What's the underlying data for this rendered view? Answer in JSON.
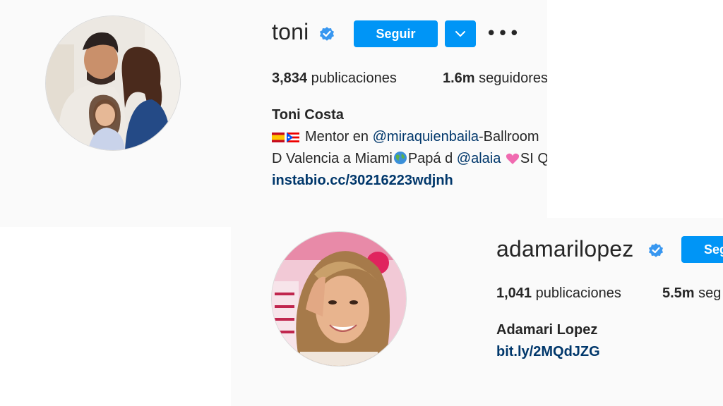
{
  "profile_1": {
    "username": "toni",
    "follow_label": "Seguir",
    "more_label": "•••",
    "posts_count": "3,834",
    "posts_label": "publicaciones",
    "followers_count": "1.6m",
    "followers_label": "seguidores",
    "full_name": "Toni Costa",
    "bio_line1_text": "Mentor en",
    "bio_line1_mention": "@miraquienbaila",
    "bio_line1_rest": "-Ballroom",
    "bio_line2_a": "D Valencia a Miami",
    "bio_line2_b": "Papá d",
    "bio_line2_mention": "@alaia",
    "bio_line2_c": "SI Q",
    "website": "instabio.cc/30216223wdjnh",
    "flag_icons": [
      "spain-flag-icon",
      "puerto-rico-flag-icon"
    ],
    "emoji_icons": [
      "globe-icon",
      "heart-icon"
    ]
  },
  "profile_2": {
    "username": "adamarilopez",
    "follow_label": "Seg",
    "posts_count": "1,041",
    "posts_label": "publicaciones",
    "followers_count": "5.5m",
    "followers_label": "seg",
    "full_name": "Adamari Lopez",
    "website": "bit.ly/2MQdJZG"
  },
  "colors": {
    "accent": "#0095f6",
    "link": "#00376b",
    "verified": "#3897f0",
    "panel_bg": "#fafafa",
    "text": "#262626"
  }
}
